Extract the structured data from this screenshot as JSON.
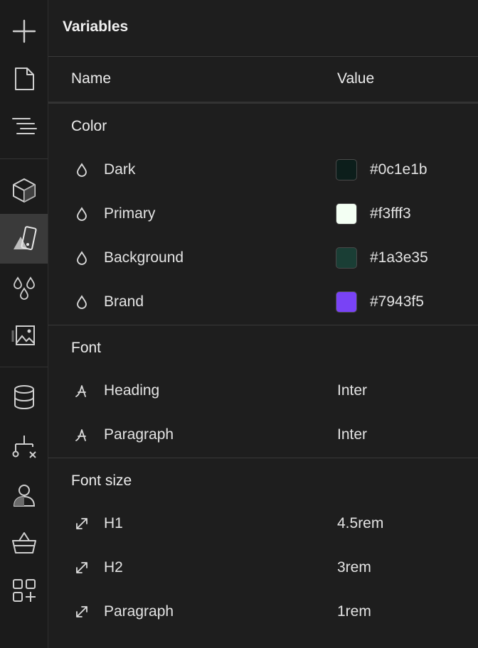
{
  "panel": {
    "title": "Variables"
  },
  "columns": {
    "name": "Name",
    "value": "Value"
  },
  "sidebar": {
    "icons": [
      "plus-icon",
      "page-icon",
      "navigator-icon",
      "components-icon",
      "style-selectors-icon",
      "variables-icon",
      "assets-icon",
      "cms-icon",
      "logic-icon",
      "users-icon",
      "ecommerce-icon",
      "apps-icon"
    ],
    "active": "style-selectors-icon"
  },
  "sections": {
    "color": {
      "title": "Color",
      "items": [
        {
          "name": "Dark",
          "value": "#0c1e1b",
          "color": "#0c1e1b"
        },
        {
          "name": "Primary",
          "value": "#f3fff3",
          "color": "#f3fff3"
        },
        {
          "name": "Background",
          "value": "#1a3e35",
          "color": "#1a3e35"
        },
        {
          "name": "Brand",
          "value": "#7943f5",
          "color": "#7943f5"
        }
      ]
    },
    "font": {
      "title": "Font",
      "items": [
        {
          "name": "Heading",
          "value": "Inter"
        },
        {
          "name": "Paragraph",
          "value": "Inter"
        }
      ]
    },
    "font_size": {
      "title": "Font size",
      "items": [
        {
          "name": "H1",
          "value": "4.5rem"
        },
        {
          "name": "H2",
          "value": "3rem"
        },
        {
          "name": "Paragraph",
          "value": "1rem"
        }
      ]
    }
  }
}
